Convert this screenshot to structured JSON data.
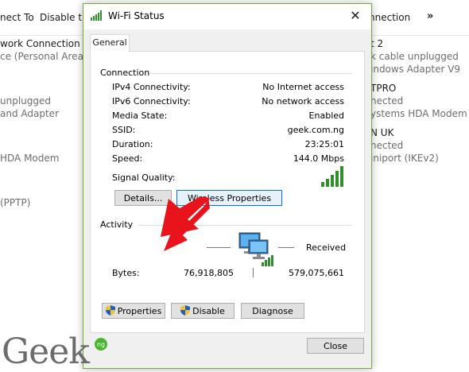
{
  "background": {
    "toolbar": {
      "connect_to": "nect To",
      "disable": "Disable thi",
      "connection": "nnection",
      "more": "»"
    },
    "left_items": [
      {
        "title": "work Connection",
        "sub": "ce (Personal Area ..."
      },
      {
        "title": "",
        "sub": "unplugged"
      },
      {
        "title": "",
        "sub": "and Adapter"
      },
      {
        "title": "",
        "sub": "HDA Modem"
      },
      {
        "title": "",
        "sub": "(PPTP)"
      }
    ],
    "right_items": [
      {
        "title": "t 2",
        "sub1": "k cable unplugged",
        "sub2": "indows Adapter V9"
      },
      {
        "title": "TPRO",
        "sub1": "nected",
        "sub2": "ystems HDA Modem"
      },
      {
        "title": "N UK",
        "sub1": "nected",
        "sub2": "iniport (IKEv2)"
      }
    ]
  },
  "dialog": {
    "title": "Wi-Fi Status",
    "close_glyph": "✕",
    "tab_general": "General",
    "connection_heading": "Connection",
    "rows": [
      {
        "label": "IPv4 Connectivity:",
        "value": "No Internet access"
      },
      {
        "label": "IPv6 Connectivity:",
        "value": "No network access"
      },
      {
        "label": "Media State:",
        "value": "Enabled"
      },
      {
        "label": "SSID:",
        "value": "geek.com.ng"
      },
      {
        "label": "Duration:",
        "value": "23:25:01"
      },
      {
        "label": "Speed:",
        "value": "144.0 Mbps"
      }
    ],
    "signal_label": "Signal Quality:",
    "signal_bars": 5,
    "details_button": "Details...",
    "wireless_properties_button": "Wireless Properties",
    "activity_heading": "Activity",
    "received_label": "Received",
    "bytes_label": "Bytes:",
    "bytes_sent": "76,918,805",
    "bytes_received": "579,075,661",
    "properties_button": "Properties",
    "disable_button": "Disable",
    "diagnose_button": "Diagnose",
    "close_button": "Close"
  },
  "watermark": {
    "logo_text": "Geek",
    "badge_text": "ng"
  },
  "colors": {
    "signal_green": "#2f8f2a",
    "arrow_red": "#e8131b",
    "focus_blue": "#0078d7",
    "border_green": "#7aa640"
  },
  "icons": [
    "wifi-signal-icon",
    "close-icon",
    "network-computers-icon",
    "uac-shield-icon",
    "red-arrow-annotation"
  ]
}
